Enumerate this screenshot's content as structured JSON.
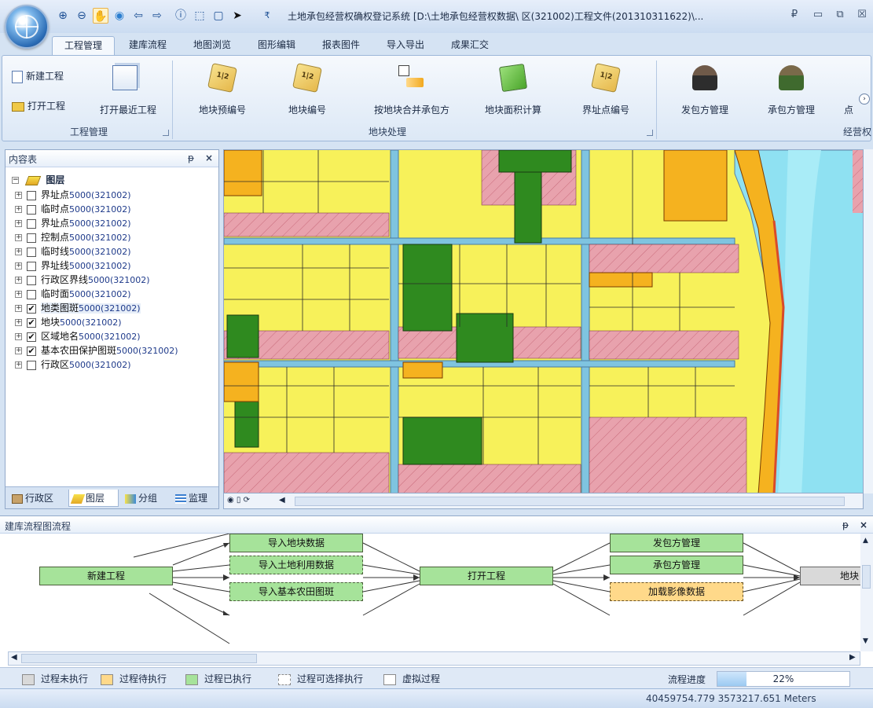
{
  "window": {
    "title": "土地承包经营权确权登记系统 [D:\\土地承包经营权数据\\  区(321002)工程文件(201310311622)\\..."
  },
  "ribbon_tabs": [
    "工程管理",
    "建库流程",
    "地图浏览",
    "图形编辑",
    "报表图件",
    "导入导出",
    "成果汇交"
  ],
  "ribbon": {
    "groups": {
      "project": "工程管理",
      "parcel": "地块处理",
      "rights": "经营权"
    },
    "buttons": {
      "new_project": "新建工程",
      "open_project": "打开工程",
      "open_recent": "打开最近工程",
      "pre_numbering": "地块预编号",
      "parcel_numbering": "地块编号",
      "merge_by_contractor": "按地块合并承包方",
      "area_calc": "地块面积计算",
      "boundary_numbering": "界址点编号",
      "issuer_mgmt": "发包方管理",
      "contractor_mgmt": "承包方管理",
      "more": "点"
    }
  },
  "left_panel": {
    "title": "内容表",
    "pin": "ᵽ",
    "close": "×",
    "root": "图层",
    "layers": [
      {
        "name": "界址点",
        "suffix": "5000(321002)",
        "checked": ""
      },
      {
        "name": "临时点",
        "suffix": "5000(321002)",
        "checked": ""
      },
      {
        "name": "界址点",
        "suffix": "5000(321002)",
        "checked": ""
      },
      {
        "name": "控制点",
        "suffix": "5000(321002)",
        "checked": ""
      },
      {
        "name": "临时线",
        "suffix": "5000(321002)",
        "checked": ""
      },
      {
        "name": "界址线",
        "suffix": "5000(321002)",
        "checked": ""
      },
      {
        "name": "行政区界线",
        "suffix": "5000(321002)",
        "checked": ""
      },
      {
        "name": "临时面",
        "suffix": "5000(321002)",
        "checked": ""
      },
      {
        "name": "地类图斑",
        "suffix": "5000(321002)",
        "checked": "✔"
      },
      {
        "name": "地块",
        "suffix": "5000(321002)",
        "checked": "✔"
      },
      {
        "name": "区域地名",
        "suffix": "5000(321002)",
        "checked": "✔"
      },
      {
        "name": "基本农田保护图斑",
        "suffix": "5000(321002)",
        "checked": "✔"
      },
      {
        "name": "行政区",
        "suffix": "5000(321002)",
        "checked": ""
      }
    ],
    "tabs": [
      "行政区",
      "图层",
      "分组",
      "监理"
    ]
  },
  "bottom_panel": {
    "title": "建库流程图流程",
    "pin": "ᵽ",
    "close": "×",
    "nodes": {
      "new_project": "新建工程",
      "import_parcel": "导入地块数据",
      "import_landuse": "导入土地利用数据",
      "import_farmland": "导入基本农田图斑",
      "open_project": "打开工程",
      "issuer_mgmt": "发包方管理",
      "contractor_mgmt": "承包方管理",
      "load_imagery": "加载影像数据",
      "parcel": "地块"
    },
    "legend": [
      "过程未执行",
      "过程待执行",
      "过程已执行",
      "过程可选择执行",
      "虚拟过程"
    ],
    "progress_label": "流程进度",
    "progress_value": 0.22,
    "progress_text": "22%"
  },
  "statusbar": {
    "coords": "40459754.779 3573217.651 Meters"
  },
  "colors": {
    "executed": "#a6e39a",
    "pending": "#ffd98a",
    "not_run": "#d9d9d9",
    "map_yellow": "#f7f15a",
    "map_dark_green": "#2f8a1f",
    "map_orange": "#f5b21f",
    "map_pink": "#e8a2ad",
    "map_water": "#8fe1f2"
  }
}
